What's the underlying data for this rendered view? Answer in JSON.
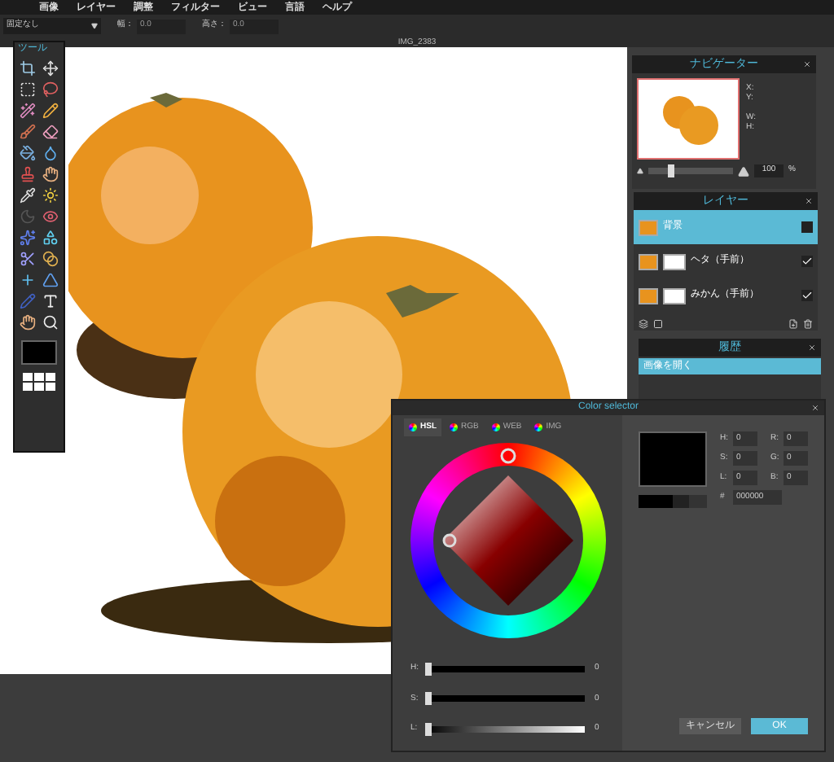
{
  "menu": [
    "画像",
    "レイヤー",
    "調整",
    "フィルター",
    "ビュー",
    "言語",
    "ヘルプ"
  ],
  "options_bar": {
    "constraint": "固定なし",
    "width_label": "幅：",
    "width_value": "0.0",
    "height_label": "高さ：",
    "height_value": "0.0"
  },
  "document": {
    "title": "IMG_2383"
  },
  "tools_panel": {
    "title": "ツール"
  },
  "navigator": {
    "title": "ナビゲーター",
    "labels": [
      "X:",
      "Y:",
      "W:",
      "H:"
    ],
    "zoom": {
      "level": 0.25,
      "value": "100",
      "unit": "%"
    }
  },
  "layers": {
    "title": "レイヤー",
    "items": [
      {
        "name": "背景",
        "selected": true,
        "visible": false,
        "kind": "image"
      },
      {
        "name": "ヘタ（手前）",
        "selected": false,
        "visible": true,
        "kind": "masked"
      },
      {
        "name": "みかん（手前）",
        "selected": false,
        "visible": true,
        "kind": "masked"
      }
    ]
  },
  "history": {
    "title": "履歴",
    "items": [
      {
        "label": "画像を開く",
        "selected": true
      }
    ]
  },
  "color_selector": {
    "title": "Color selector",
    "tabs": [
      {
        "label": "HSL",
        "selected": true
      },
      {
        "label": "RGB",
        "selected": false
      },
      {
        "label": "WEB",
        "selected": false
      },
      {
        "label": "IMG",
        "selected": false
      }
    ],
    "fields": [
      {
        "label": "H:",
        "value": "0"
      },
      {
        "label": "R:",
        "value": "0"
      },
      {
        "label": "S:",
        "value": "0"
      },
      {
        "label": "G:",
        "value": "0"
      },
      {
        "label": "L:",
        "value": "0"
      },
      {
        "label": "B:",
        "value": "0"
      }
    ],
    "hex_label": "#",
    "hex": "000000",
    "sliders": [
      {
        "label": "H:",
        "level": 0,
        "value": "0"
      },
      {
        "label": "S:",
        "level": 0,
        "value": "0"
      },
      {
        "label": "L:",
        "level": 0,
        "value": "0"
      }
    ],
    "buttons": [
      {
        "label": "キャンセル",
        "kind": "secondary"
      },
      {
        "label": "OK",
        "kind": "primary"
      }
    ]
  }
}
